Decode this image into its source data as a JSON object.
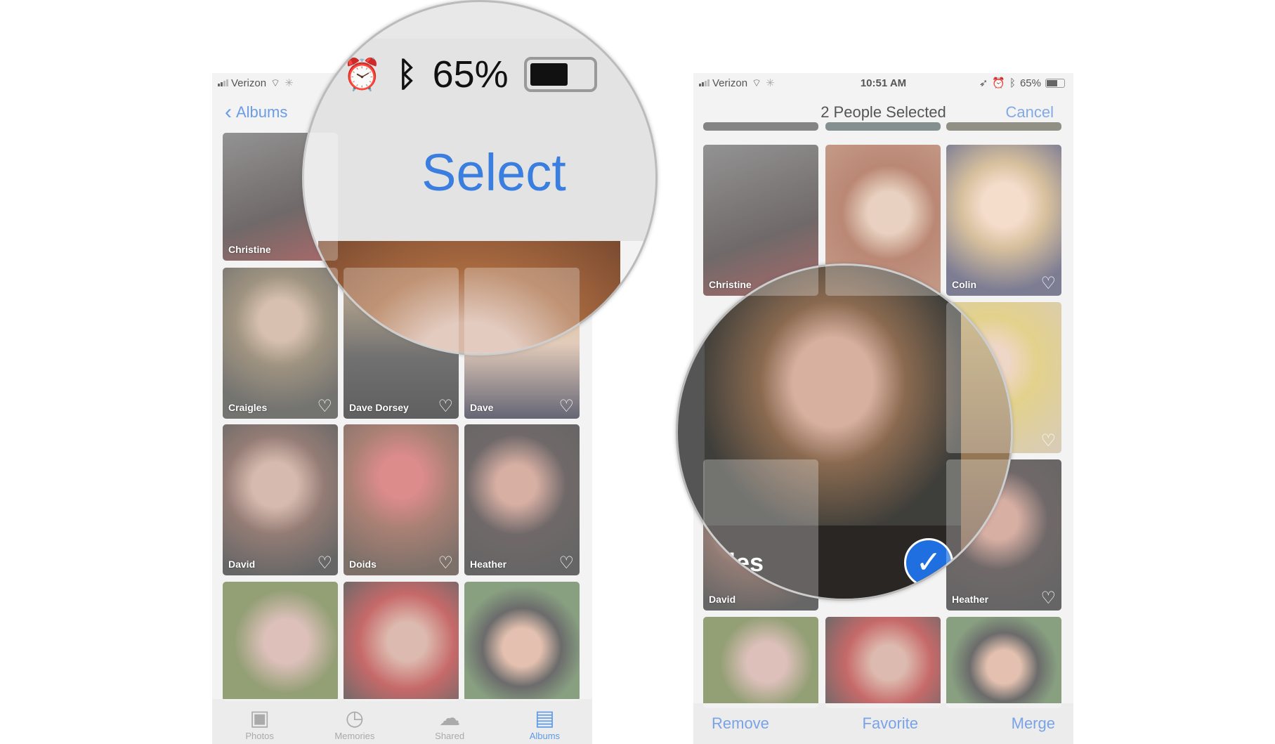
{
  "left": {
    "status": {
      "carrier": "Verizon"
    },
    "nav": {
      "back_label": "Albums"
    },
    "tiles": [
      {
        "name": "Christine",
        "heart": false
      },
      {
        "name": "Craigles",
        "heart": true
      },
      {
        "name": "Dave Dorsey",
        "heart": true
      },
      {
        "name": "Dave",
        "heart": true
      },
      {
        "name": "David",
        "heart": true
      },
      {
        "name": "Doids",
        "heart": true
      },
      {
        "name": "Heather",
        "heart": true
      },
      {
        "name": "",
        "heart": false
      },
      {
        "name": "",
        "heart": false
      },
      {
        "name": "",
        "heart": false
      }
    ],
    "tabs": [
      {
        "label": "Photos",
        "icon": "photos-icon",
        "active": false
      },
      {
        "label": "Memories",
        "icon": "memories-icon",
        "active": false
      },
      {
        "label": "Shared",
        "icon": "cloud-icon",
        "active": false
      },
      {
        "label": "Albums",
        "icon": "albums-icon",
        "active": true
      }
    ],
    "magnifier": {
      "battery": "65%",
      "select_label": "Select"
    }
  },
  "right": {
    "status": {
      "carrier": "Verizon",
      "time": "10:51 AM",
      "battery": "65%"
    },
    "nav": {
      "title": "2 People Selected",
      "cancel_label": "Cancel"
    },
    "tiles": [
      {
        "name": "Christine"
      },
      {
        "name": ""
      },
      {
        "name": "Colin"
      },
      {
        "name": "David"
      },
      {
        "name": "Heather"
      }
    ],
    "toolbar": {
      "remove": "Remove",
      "favorite": "Favorite",
      "merge": "Merge"
    },
    "magnifier": {
      "name": "Craigles",
      "selected": true
    }
  },
  "colors": {
    "accent": "#4a8ae6",
    "check": "#1f6fe0"
  }
}
